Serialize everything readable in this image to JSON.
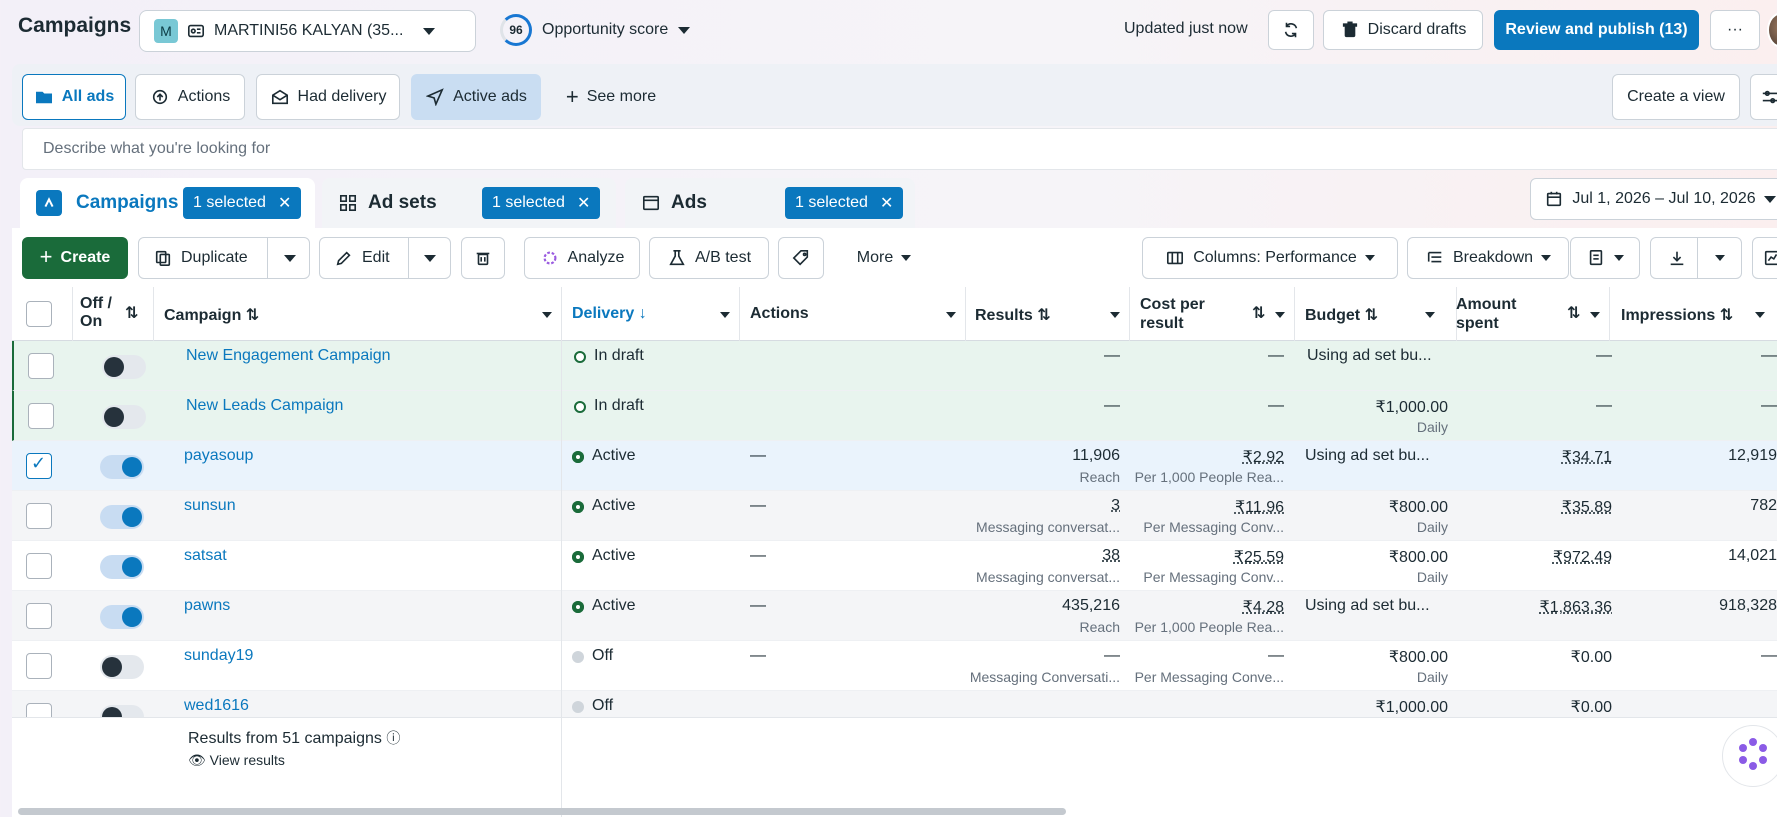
{
  "header": {
    "title": "Campaigns",
    "account_initial": "M",
    "account_name": "MARTINI56 KALYAN (35...",
    "opportunity_score": "96",
    "opportunity_label": "Opportunity score",
    "updated": "Updated just now",
    "discard": "Discard drafts",
    "publish": "Review and publish (13)",
    "more": "···"
  },
  "filters": {
    "all_ads": "All ads",
    "actions": "Actions",
    "had_delivery": "Had delivery",
    "active_ads": "Active ads",
    "see_more": "See more",
    "create_view": "Create a view"
  },
  "search": {
    "placeholder": "Describe what you're looking for"
  },
  "tabs": {
    "campaigns": "Campaigns",
    "ad_sets": "Ad sets",
    "ads": "Ads",
    "selected": "1 selected"
  },
  "date_range": "Jul 1, 2026 – Jul 10, 2026",
  "toolbar": {
    "create": "Create",
    "duplicate": "Duplicate",
    "edit": "Edit",
    "analyze": "Analyze",
    "ab_test": "A/B test",
    "more": "More",
    "columns": "Columns: Performance",
    "breakdown": "Breakdown"
  },
  "columns": {
    "offon_1": "Off /",
    "offon_2": "On",
    "campaign": "Campaign",
    "delivery": "Delivery",
    "actions": "Actions",
    "results": "Results",
    "cpr_1": "Cost per",
    "cpr_2": "result",
    "budget": "Budget",
    "spent_1": "Amount",
    "spent_2": "spent",
    "impressions": "Impressions"
  },
  "rows": [
    {
      "name": "New Engagement Campaign",
      "status": "In draft",
      "actions": "",
      "results": "—",
      "results_sub": "",
      "cpr": "—",
      "cpr_sub": "",
      "budget": "Using ad set bu...",
      "budget_sub": "",
      "spent": "—",
      "impressions": "—"
    },
    {
      "name": "New Leads Campaign",
      "status": "In draft",
      "actions": "",
      "results": "—",
      "results_sub": "",
      "cpr": "—",
      "cpr_sub": "",
      "budget": "₹1,000.00",
      "budget_sub": "Daily",
      "spent": "—",
      "impressions": "—"
    },
    {
      "name": "payasoup",
      "status": "Active",
      "actions": "—",
      "results": "11,906",
      "results_sub": "Reach",
      "cpr": "₹2.92",
      "cpr_sub": "Per 1,000 People Rea...",
      "budget": "Using ad set bu...",
      "budget_sub": "",
      "spent": "₹34.71",
      "impressions": "12,919"
    },
    {
      "name": "sunsun",
      "status": "Active",
      "actions": "—",
      "results": "3",
      "results_sub": "Messaging conversat...",
      "cpr": "₹11.96",
      "cpr_sub": "Per Messaging Conv...",
      "budget": "₹800.00",
      "budget_sub": "Daily",
      "spent": "₹35.89",
      "impressions": "782"
    },
    {
      "name": "satsat",
      "status": "Active",
      "actions": "—",
      "results": "38",
      "results_sub": "Messaging conversat...",
      "cpr": "₹25.59",
      "cpr_sub": "Per Messaging Conv...",
      "budget": "₹800.00",
      "budget_sub": "Daily",
      "spent": "₹972.49",
      "impressions": "14,021"
    },
    {
      "name": "pawns",
      "status": "Active",
      "actions": "—",
      "results": "435,216",
      "results_sub": "Reach",
      "cpr": "₹4.28",
      "cpr_sub": "Per 1,000 People Rea...",
      "budget": "Using ad set bu...",
      "budget_sub": "",
      "spent": "₹1,863.36",
      "impressions": "918,328"
    },
    {
      "name": "sunday19",
      "status": "Off",
      "actions": "—",
      "results": "—",
      "results_sub": "Messaging Conversati...",
      "cpr": "—",
      "cpr_sub": "Per Messaging Conve...",
      "budget": "₹800.00",
      "budget_sub": "Daily",
      "spent": "₹0.00",
      "impressions": "—"
    },
    {
      "name": "wed1616",
      "status": "Off",
      "actions": "",
      "results": "",
      "results_sub": "",
      "cpr": "",
      "cpr_sub": "",
      "budget": "₹1,000.00",
      "budget_sub": "",
      "spent": "₹0.00",
      "impressions": ""
    }
  ],
  "footer": {
    "summary": "Results from 51 campaigns",
    "view_results": "View results"
  }
}
